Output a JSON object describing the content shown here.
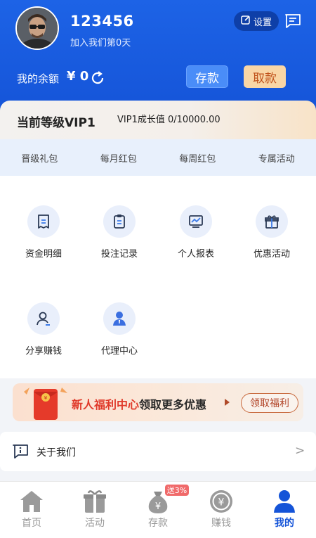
{
  "profile": {
    "username": "123456",
    "join_text": "加入我们第0天",
    "settings_label": "设置"
  },
  "balance": {
    "label": "我的余额",
    "value": "¥ 0",
    "deposit_label": "存款",
    "withdraw_label": "取款"
  },
  "vip": {
    "level_text": "当前等级VIP1",
    "growth_text": "VIP1成长值 0/10000.00"
  },
  "tabs": [
    {
      "label": "晋级礼包"
    },
    {
      "label": "每月红包"
    },
    {
      "label": "每周红包"
    },
    {
      "label": "专属活动"
    }
  ],
  "grid": [
    {
      "label": "资金明细",
      "icon": "receipt-icon"
    },
    {
      "label": "投注记录",
      "icon": "clipboard-icon"
    },
    {
      "label": "个人报表",
      "icon": "chart-icon"
    },
    {
      "label": "优惠活动",
      "icon": "gift-icon"
    },
    {
      "label": "分享赚钱",
      "icon": "user-share-icon"
    },
    {
      "label": "代理中心",
      "icon": "agent-icon"
    }
  ],
  "banner": {
    "highlight": "新人福利中心",
    "rest": "领取更多优惠",
    "button_label": "领取福利"
  },
  "about": {
    "label": "关于我们",
    "chevron": ">"
  },
  "nav": {
    "items": [
      {
        "label": "首页",
        "icon": "home-icon"
      },
      {
        "label": "活动",
        "icon": "gift-box-icon"
      },
      {
        "label": "存款",
        "icon": "money-bag-icon"
      },
      {
        "label": "赚钱",
        "icon": "coin-icon"
      },
      {
        "label": "我的",
        "icon": "person-icon"
      }
    ],
    "promo_badge": "送3%",
    "active_index": 4
  },
  "colors": {
    "primary": "#1554d8",
    "withdraw_bg": "#f9d6a6",
    "badge_red": "#f06a6a"
  }
}
